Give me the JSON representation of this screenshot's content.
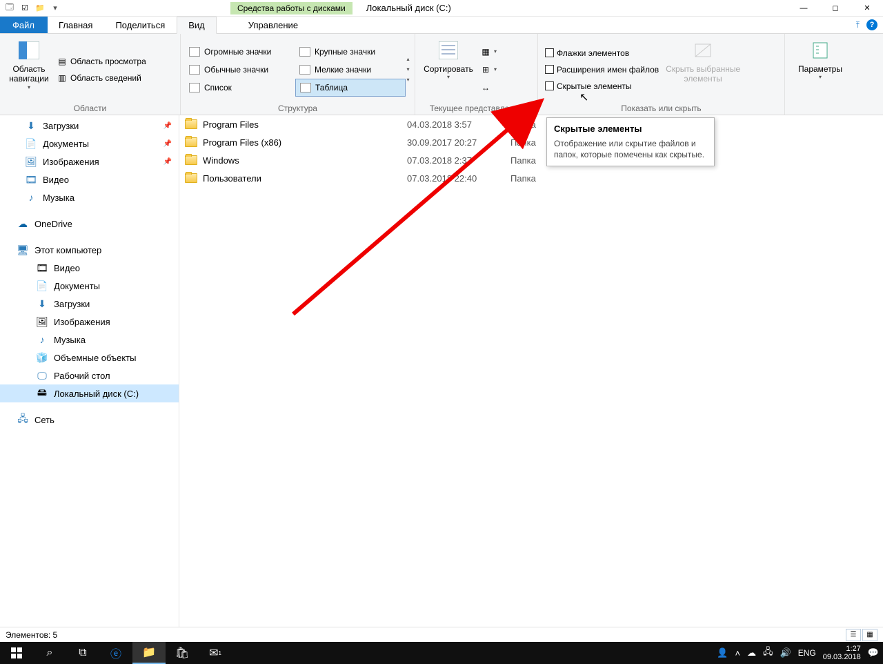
{
  "titlebar": {
    "disk_tools": "Средства работы с дисками",
    "title": "Локальный диск (C:)"
  },
  "tabs": {
    "file": "Файл",
    "home": "Главная",
    "share": "Поделиться",
    "view": "Вид",
    "manage": "Управление"
  },
  "ribbon": {
    "panes": {
      "nav_pane": "Область навигации",
      "preview": "Область просмотра",
      "details": "Область сведений",
      "group": "Области"
    },
    "layout": {
      "xl": "Огромные значки",
      "lg": "Крупные значки",
      "md": "Обычные значки",
      "sm": "Мелкие значки",
      "list": "Список",
      "table": "Таблица",
      "group": "Структура"
    },
    "current_view": {
      "sort": "Сортировать",
      "group": "Текущее представление"
    },
    "show_hide": {
      "item_check": "Флажки элементов",
      "file_ext": "Расширения имен файлов",
      "hidden": "Скрытые элементы",
      "hide_selected": "Скрыть выбранные элементы",
      "group": "Показать или скрыть"
    },
    "options": "Параметры"
  },
  "nav": {
    "downloads": "Загрузки",
    "documents": "Документы",
    "pictures": "Изображения",
    "videos": "Видео",
    "music": "Музыка",
    "onedrive": "OneDrive",
    "this_pc": "Этот компьютер",
    "pc_videos": "Видео",
    "pc_documents": "Документы",
    "pc_downloads": "Загрузки",
    "pc_pictures": "Изображения",
    "pc_music": "Музыка",
    "pc_3d": "Объемные объекты",
    "pc_desktop": "Рабочий стол",
    "pc_disk_c": "Локальный диск (C:)",
    "network": "Сеть"
  },
  "files": [
    {
      "name": "Program Files",
      "date": "04.03.2018 3:57",
      "type": "Папка"
    },
    {
      "name": "Program Files (x86)",
      "date": "30.09.2017 20:27",
      "type": "Папка"
    },
    {
      "name": "Windows",
      "date": "07.03.2018 2:37",
      "type": "Папка"
    },
    {
      "name": "Пользователи",
      "date": "07.03.2018 22:40",
      "type": "Папка"
    }
  ],
  "tooltip": {
    "title": "Скрытые элементы",
    "body": "Отображение или скрытие файлов и папок, которые помечены как скрытые."
  },
  "statusbar": {
    "items": "Элементов: 5"
  },
  "tray": {
    "lang": "ENG",
    "time": "1:27",
    "date": "09.03.2018"
  }
}
